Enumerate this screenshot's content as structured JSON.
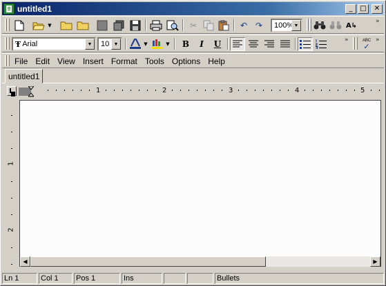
{
  "window": {
    "title": "untitled1"
  },
  "title_buttons": {
    "minimize": "_",
    "maximize": "□",
    "close": "✕"
  },
  "toolbar": {
    "zoom": "100%",
    "font_name": "Arial",
    "font_size": "10",
    "bold": "B",
    "italic": "I",
    "underline": "U",
    "spell_check": "ABC"
  },
  "menu": [
    "File",
    "Edit",
    "View",
    "Insert",
    "Format",
    "Tools",
    "Options",
    "Help"
  ],
  "tabs": [
    {
      "label": "untitled1"
    }
  ],
  "ruler": {
    "h_numbers": [
      "1",
      "2",
      "3",
      "4",
      "5"
    ],
    "v_numbers": [
      "1",
      "2"
    ]
  },
  "status": {
    "line": "Ln 1",
    "col": "Col 1",
    "pos": "Pos 1",
    "mode": "Ins",
    "style": "Bullets"
  }
}
